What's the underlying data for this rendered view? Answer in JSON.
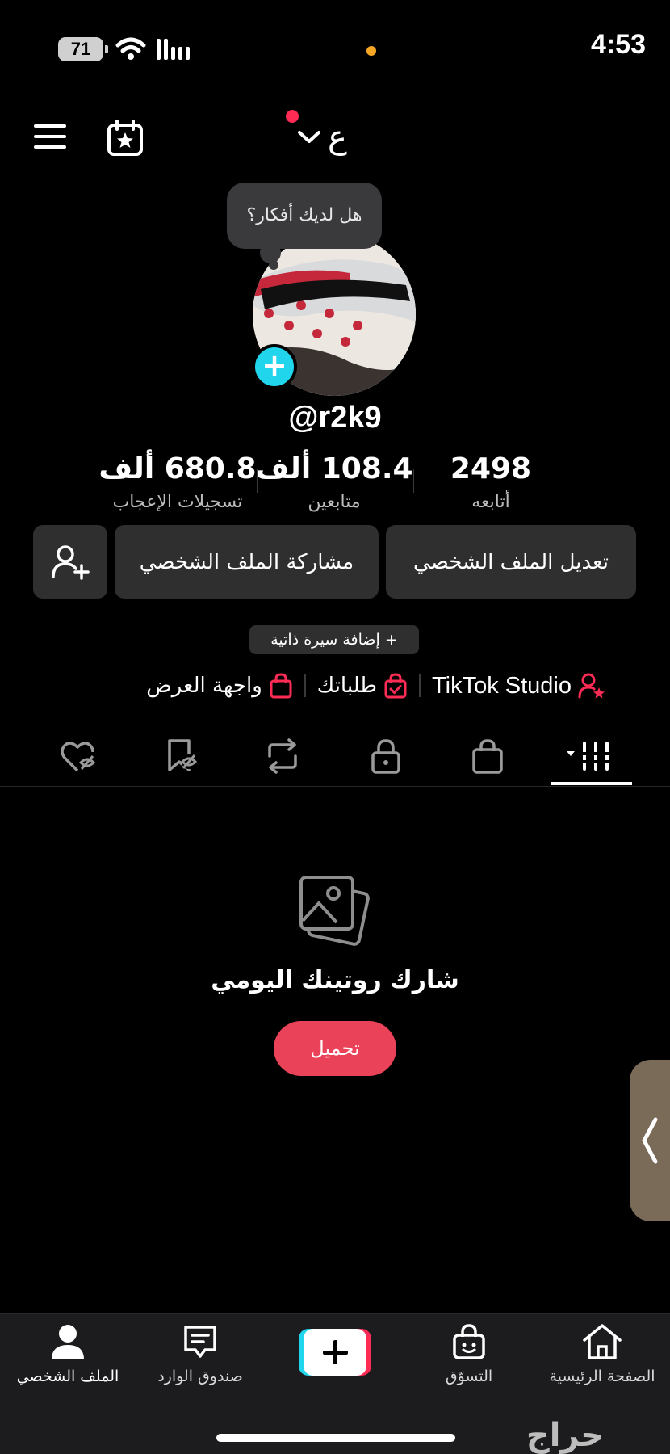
{
  "status_bar": {
    "time": "4:53",
    "battery": "71"
  },
  "header": {
    "account_label": "ع"
  },
  "profile": {
    "bubble_text": "هل لديك أفكار؟",
    "username": "@r2k9"
  },
  "stats": [
    {
      "value": "2498",
      "label": "أتابعه"
    },
    {
      "value": "108.4 ألف",
      "label": "متابعين"
    },
    {
      "value": "680.8 ألف",
      "label": "تسجيلات الإعجاب"
    }
  ],
  "actions": {
    "edit_profile": "تعديل الملف الشخصي",
    "share_profile": "مشاركة الملف الشخصي",
    "add_bio": "+ إضافة سيرة ذاتية"
  },
  "links": {
    "studio": "TikTok Studio",
    "orders": "طلباتك",
    "showcase": "واجهة العرض"
  },
  "empty_state": {
    "title": "شارك روتينك اليومي",
    "upload": "تحميل"
  },
  "bottom_nav": {
    "home": "الصفحة الرئيسية",
    "shop": "التسوّق",
    "inbox": "صندوق الوارد",
    "profile": "الملف الشخصي"
  },
  "watermark": "حراج",
  "colors": {
    "accent": "#fe2c55",
    "upload_button": "#ea4359",
    "avatar_plus": "#20d5ec",
    "button_bg": "#2f2f2f"
  },
  "icons": [
    "menu-icon",
    "calendar-star-icon",
    "chevron-down-icon",
    "plus-icon",
    "add-friend-icon",
    "person-star-icon",
    "bag-check-icon",
    "bag-icon",
    "grid-icon",
    "lock-icon",
    "repost-icon",
    "bookmark-icon",
    "heart-hidden-icon",
    "photo-stack-icon",
    "home-icon",
    "inbox-icon",
    "profile-icon"
  ]
}
